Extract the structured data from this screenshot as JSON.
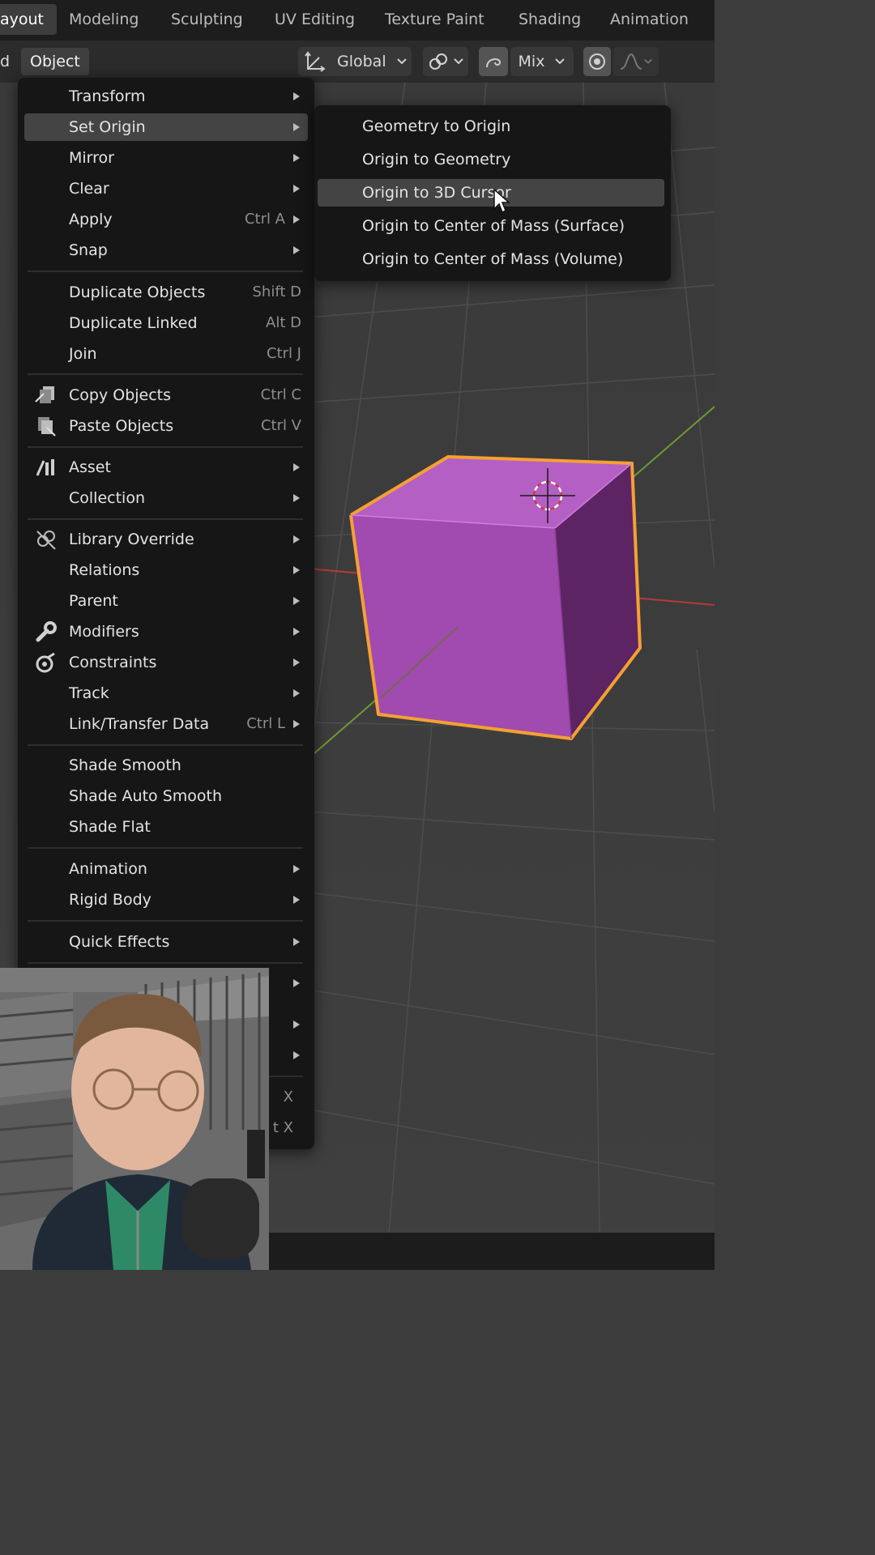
{
  "workspace_tabs": [
    "ayout",
    "Modeling",
    "Sculpting",
    "UV Editing",
    "Texture Paint",
    "Shading",
    "Animation"
  ],
  "header": {
    "left_fragment": "d",
    "object_menu": "Object",
    "transform_orientation": "Global",
    "proportional_mode": "Mix"
  },
  "object_menu": {
    "items": [
      {
        "label": "Transform",
        "shortcut": "",
        "submenu": true
      },
      {
        "label": "Set Origin",
        "shortcut": "",
        "submenu": true
      },
      {
        "label": "Mirror",
        "shortcut": "",
        "submenu": true
      },
      {
        "label": "Clear",
        "shortcut": "",
        "submenu": true
      },
      {
        "label": "Apply",
        "shortcut": "Ctrl A",
        "submenu": true
      },
      {
        "label": "Snap",
        "shortcut": "",
        "submenu": true
      },
      {
        "label": "Duplicate Objects",
        "shortcut": "Shift D",
        "submenu": false
      },
      {
        "label": "Duplicate Linked",
        "shortcut": "Alt D",
        "submenu": false
      },
      {
        "label": "Join",
        "shortcut": "Ctrl J",
        "submenu": false
      },
      {
        "label": "Copy Objects",
        "shortcut": "Ctrl C",
        "submenu": false
      },
      {
        "label": "Paste Objects",
        "shortcut": "Ctrl V",
        "submenu": false
      },
      {
        "label": "Asset",
        "shortcut": "",
        "submenu": true
      },
      {
        "label": "Collection",
        "shortcut": "",
        "submenu": true
      },
      {
        "label": "Library Override",
        "shortcut": "",
        "submenu": true
      },
      {
        "label": "Relations",
        "shortcut": "",
        "submenu": true
      },
      {
        "label": "Parent",
        "shortcut": "",
        "submenu": true
      },
      {
        "label": "Modifiers",
        "shortcut": "",
        "submenu": true
      },
      {
        "label": "Constraints",
        "shortcut": "",
        "submenu": true
      },
      {
        "label": "Track",
        "shortcut": "",
        "submenu": true
      },
      {
        "label": "Link/Transfer Data",
        "shortcut": "Ctrl L",
        "submenu": true
      },
      {
        "label": "Shade Smooth",
        "shortcut": "",
        "submenu": false
      },
      {
        "label": "Shade Auto Smooth",
        "shortcut": "",
        "submenu": false
      },
      {
        "label": "Shade Flat",
        "shortcut": "",
        "submenu": false
      },
      {
        "label": "Animation",
        "shortcut": "",
        "submenu": true
      },
      {
        "label": "Rigid Body",
        "shortcut": "",
        "submenu": true
      },
      {
        "label": "Quick Effects",
        "shortcut": "",
        "submenu": true
      }
    ],
    "partial_shortcuts": [
      "X",
      "t X"
    ]
  },
  "set_origin_submenu": {
    "items": [
      "Geometry to Origin",
      "Origin to Geometry",
      "Origin to 3D Cursor",
      "Origin to Center of Mass (Surface)",
      "Origin to Center of Mass (Volume)"
    ],
    "highlighted": "Origin to 3D Cursor"
  },
  "colors": {
    "accent_selection": "#f5a033",
    "object_color": "#a949b8",
    "menu_bg": "#161616",
    "menu_highlight": "#444444",
    "x_axis": "#b33b3b",
    "y_axis": "#6e9a33"
  },
  "icons": {
    "transform_pivot": "transform-orientation-icon",
    "snap": "snap-icon",
    "proportional": "proportional-edit-icon",
    "falloff": "falloff-curve-icon",
    "copy": "copy-objects-icon",
    "paste": "paste-objects-icon",
    "asset": "asset-icon",
    "library": "library-override-icon",
    "modifiers": "wrench-icon",
    "constraints": "constraint-icon"
  }
}
